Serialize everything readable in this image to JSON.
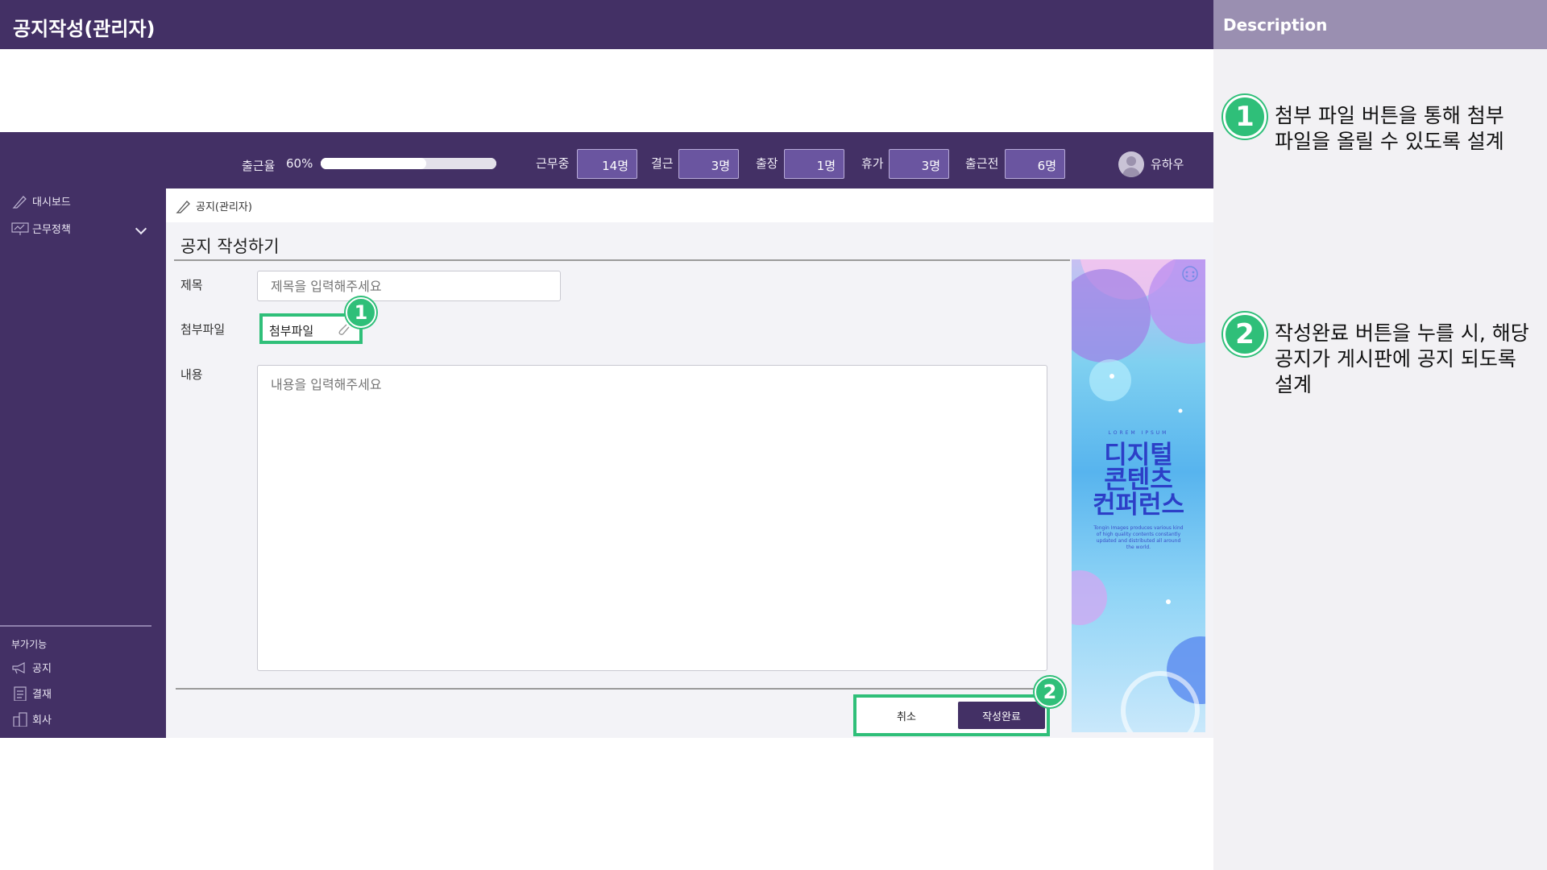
{
  "page_title": "공지작성(관리자)",
  "description": {
    "header": "Description",
    "items": [
      {
        "number": "1",
        "text": "첨부 파일 버튼을 통해 첨부 파일을 올릴 수 있도록 설계"
      },
      {
        "number": "2",
        "text": "작성완료 버튼을 누를 시, 해당 공지가 게시판에 공지 되도록 설계"
      }
    ]
  },
  "header": {
    "attendance_label": "출근율",
    "attendance_percent": "60%",
    "attendance_progress": 0.6,
    "stats": [
      {
        "label": "근무중",
        "value": "14명"
      },
      {
        "label": "결근",
        "value": "3명"
      },
      {
        "label": "출장",
        "value": "1명"
      },
      {
        "label": "휴가",
        "value": "3명"
      },
      {
        "label": "출근전",
        "value": "6명"
      }
    ],
    "user_name": "유하우"
  },
  "sidebar": {
    "items": [
      {
        "label": "대시보드",
        "icon": "pencil-icon"
      },
      {
        "label": "근무정책",
        "icon": "presentation-icon"
      }
    ],
    "section_label": "부가기능",
    "extra_items": [
      {
        "label": "공지",
        "icon": "megaphone-icon"
      },
      {
        "label": "결재",
        "icon": "clipboard-icon"
      },
      {
        "label": "회사",
        "icon": "building-icon"
      }
    ]
  },
  "breadcrumb": "공지(관리자)",
  "form": {
    "title": "공지 작성하기",
    "subject_label": "제목",
    "subject_placeholder": "제목을 입력해주세요",
    "attach_label": "첨부파일",
    "attach_button": "첨부파일",
    "content_label": "내용",
    "content_placeholder": "내용을 입력해주세요",
    "cancel_button": "취소",
    "submit_button": "작성완료",
    "callout_1": "1",
    "callout_2": "2"
  },
  "banner": {
    "small_top": "LOREM IPSUM",
    "headline_1": "디지털",
    "headline_2": "콘텐츠",
    "headline_3": "컨퍼런스",
    "small_bottom": "Tongin Images produces various kind of high quality contents constantly updated and distributed all around the world."
  }
}
